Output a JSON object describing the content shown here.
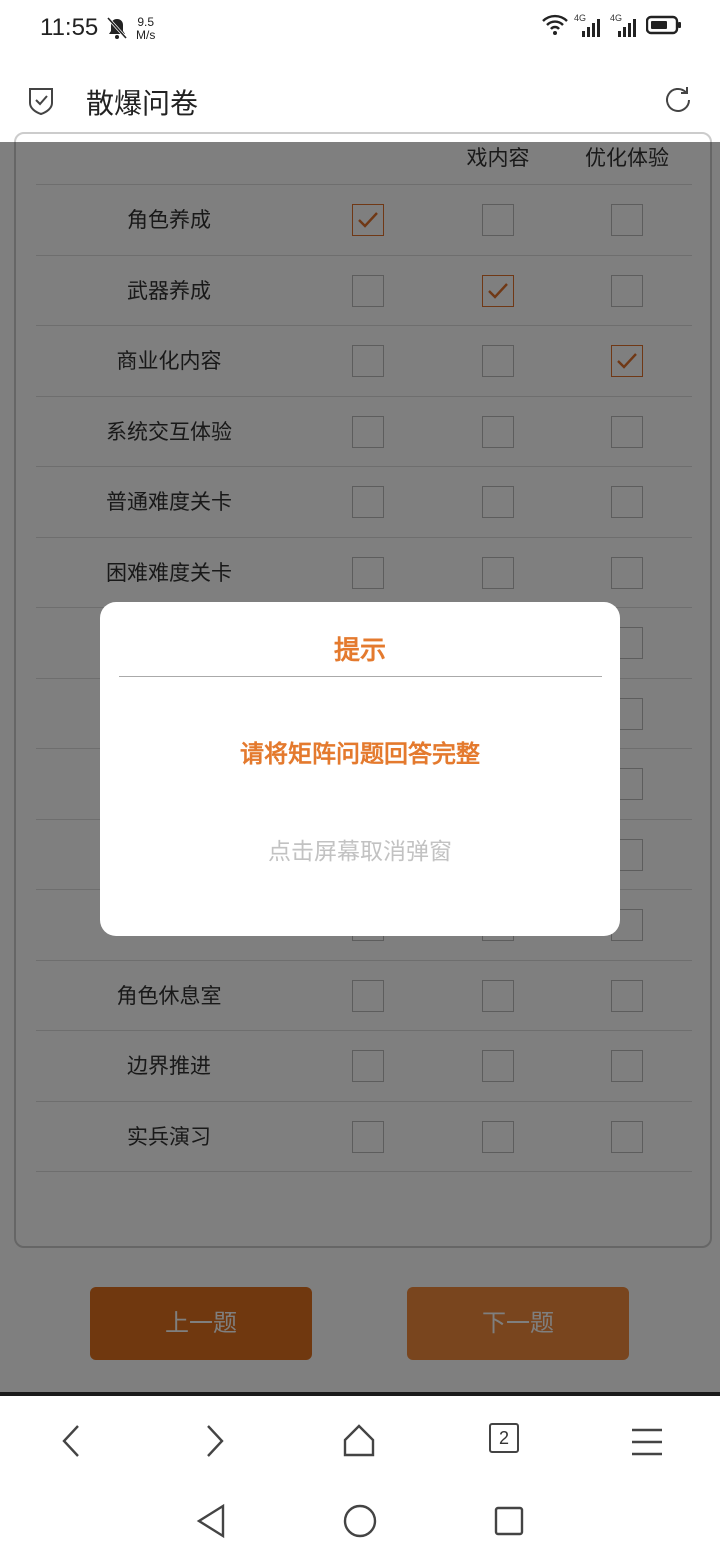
{
  "status_bar": {
    "time": "11:55",
    "speed_value": "9.5",
    "speed_unit": "M/s",
    "net1": "4G",
    "net2": "4G"
  },
  "header": {
    "title": "散爆问卷"
  },
  "matrix": {
    "columns": [
      "戏内容",
      "优化体验"
    ],
    "rows": [
      {
        "label": "角色养成",
        "checked": [
          true,
          false,
          false
        ]
      },
      {
        "label": "武器养成",
        "checked": [
          false,
          true,
          false
        ]
      },
      {
        "label": "商业化内容",
        "checked": [
          false,
          false,
          true
        ]
      },
      {
        "label": "系统交互体验",
        "checked": [
          false,
          false,
          false
        ]
      },
      {
        "label": "普通难度关卡",
        "checked": [
          false,
          false,
          false
        ]
      },
      {
        "label": "困难难度关卡",
        "checked": [
          false,
          false,
          false
        ]
      },
      {
        "label": "",
        "checked": [
          false,
          false,
          false
        ]
      },
      {
        "label": "",
        "checked": [
          false,
          false,
          false
        ]
      },
      {
        "label": "",
        "checked": [
          false,
          false,
          false
        ]
      },
      {
        "label": "",
        "checked": [
          false,
          false,
          false
        ]
      },
      {
        "label": "",
        "checked": [
          false,
          false,
          false
        ]
      },
      {
        "label": "角色休息室",
        "checked": [
          false,
          false,
          false
        ]
      },
      {
        "label": "边界推进",
        "checked": [
          false,
          false,
          false
        ]
      },
      {
        "label": "实兵演习",
        "checked": [
          false,
          false,
          false
        ]
      }
    ]
  },
  "navigation": {
    "prev_label": "上一题",
    "next_label": "下一题"
  },
  "modal": {
    "title": "提示",
    "message": "请将矩阵问题回答完整",
    "hint": "点击屏幕取消弹窗"
  },
  "browser": {
    "tab_count": "2"
  },
  "colors": {
    "accent": "#e47a2e",
    "check": "#e0702a"
  }
}
